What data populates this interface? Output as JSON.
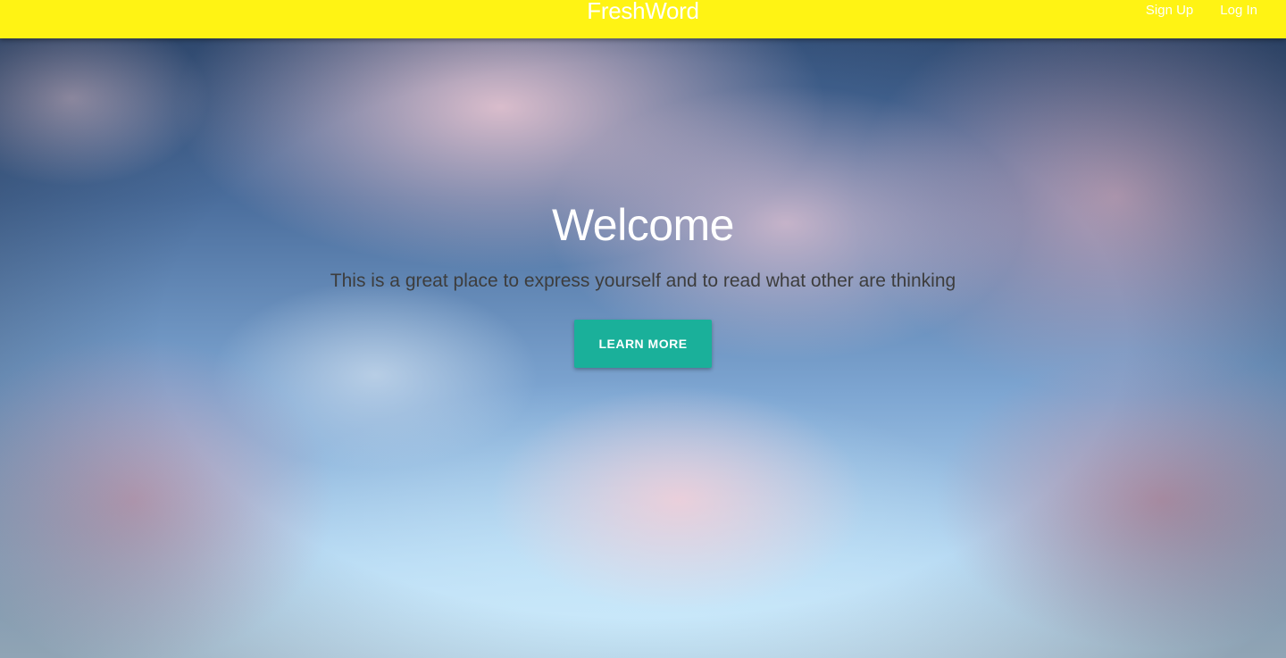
{
  "navbar": {
    "brand": "FreshWord",
    "links": [
      {
        "label": "Sign Up"
      },
      {
        "label": "Log In"
      }
    ],
    "background_color": "#fff314"
  },
  "hero": {
    "title": "Welcome",
    "subtitle": "This is a great place to express yourself and to read what other are thinking",
    "cta_label": "LEARN MORE",
    "cta_color": "#1ab09a"
  }
}
